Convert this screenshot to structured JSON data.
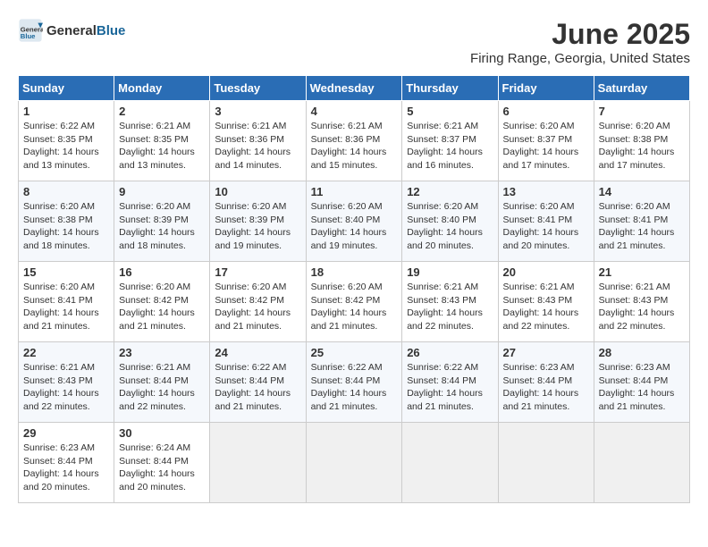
{
  "header": {
    "logo_general": "General",
    "logo_blue": "Blue",
    "month": "June 2025",
    "location": "Firing Range, Georgia, United States"
  },
  "weekdays": [
    "Sunday",
    "Monday",
    "Tuesday",
    "Wednesday",
    "Thursday",
    "Friday",
    "Saturday"
  ],
  "weeks": [
    [
      {
        "day": "1",
        "sunrise": "6:22 AM",
        "sunset": "8:35 PM",
        "daylight": "14 hours and 13 minutes."
      },
      {
        "day": "2",
        "sunrise": "6:21 AM",
        "sunset": "8:35 PM",
        "daylight": "14 hours and 13 minutes."
      },
      {
        "day": "3",
        "sunrise": "6:21 AM",
        "sunset": "8:36 PM",
        "daylight": "14 hours and 14 minutes."
      },
      {
        "day": "4",
        "sunrise": "6:21 AM",
        "sunset": "8:36 PM",
        "daylight": "14 hours and 15 minutes."
      },
      {
        "day": "5",
        "sunrise": "6:21 AM",
        "sunset": "8:37 PM",
        "daylight": "14 hours and 16 minutes."
      },
      {
        "day": "6",
        "sunrise": "6:20 AM",
        "sunset": "8:37 PM",
        "daylight": "14 hours and 17 minutes."
      },
      {
        "day": "7",
        "sunrise": "6:20 AM",
        "sunset": "8:38 PM",
        "daylight": "14 hours and 17 minutes."
      }
    ],
    [
      {
        "day": "8",
        "sunrise": "6:20 AM",
        "sunset": "8:38 PM",
        "daylight": "14 hours and 18 minutes."
      },
      {
        "day": "9",
        "sunrise": "6:20 AM",
        "sunset": "8:39 PM",
        "daylight": "14 hours and 18 minutes."
      },
      {
        "day": "10",
        "sunrise": "6:20 AM",
        "sunset": "8:39 PM",
        "daylight": "14 hours and 19 minutes."
      },
      {
        "day": "11",
        "sunrise": "6:20 AM",
        "sunset": "8:40 PM",
        "daylight": "14 hours and 19 minutes."
      },
      {
        "day": "12",
        "sunrise": "6:20 AM",
        "sunset": "8:40 PM",
        "daylight": "14 hours and 20 minutes."
      },
      {
        "day": "13",
        "sunrise": "6:20 AM",
        "sunset": "8:41 PM",
        "daylight": "14 hours and 20 minutes."
      },
      {
        "day": "14",
        "sunrise": "6:20 AM",
        "sunset": "8:41 PM",
        "daylight": "14 hours and 21 minutes."
      }
    ],
    [
      {
        "day": "15",
        "sunrise": "6:20 AM",
        "sunset": "8:41 PM",
        "daylight": "14 hours and 21 minutes."
      },
      {
        "day": "16",
        "sunrise": "6:20 AM",
        "sunset": "8:42 PM",
        "daylight": "14 hours and 21 minutes."
      },
      {
        "day": "17",
        "sunrise": "6:20 AM",
        "sunset": "8:42 PM",
        "daylight": "14 hours and 21 minutes."
      },
      {
        "day": "18",
        "sunrise": "6:20 AM",
        "sunset": "8:42 PM",
        "daylight": "14 hours and 21 minutes."
      },
      {
        "day": "19",
        "sunrise": "6:21 AM",
        "sunset": "8:43 PM",
        "daylight": "14 hours and 22 minutes."
      },
      {
        "day": "20",
        "sunrise": "6:21 AM",
        "sunset": "8:43 PM",
        "daylight": "14 hours and 22 minutes."
      },
      {
        "day": "21",
        "sunrise": "6:21 AM",
        "sunset": "8:43 PM",
        "daylight": "14 hours and 22 minutes."
      }
    ],
    [
      {
        "day": "22",
        "sunrise": "6:21 AM",
        "sunset": "8:43 PM",
        "daylight": "14 hours and 22 minutes."
      },
      {
        "day": "23",
        "sunrise": "6:21 AM",
        "sunset": "8:44 PM",
        "daylight": "14 hours and 22 minutes."
      },
      {
        "day": "24",
        "sunrise": "6:22 AM",
        "sunset": "8:44 PM",
        "daylight": "14 hours and 21 minutes."
      },
      {
        "day": "25",
        "sunrise": "6:22 AM",
        "sunset": "8:44 PM",
        "daylight": "14 hours and 21 minutes."
      },
      {
        "day": "26",
        "sunrise": "6:22 AM",
        "sunset": "8:44 PM",
        "daylight": "14 hours and 21 minutes."
      },
      {
        "day": "27",
        "sunrise": "6:23 AM",
        "sunset": "8:44 PM",
        "daylight": "14 hours and 21 minutes."
      },
      {
        "day": "28",
        "sunrise": "6:23 AM",
        "sunset": "8:44 PM",
        "daylight": "14 hours and 21 minutes."
      }
    ],
    [
      {
        "day": "29",
        "sunrise": "6:23 AM",
        "sunset": "8:44 PM",
        "daylight": "14 hours and 20 minutes."
      },
      {
        "day": "30",
        "sunrise": "6:24 AM",
        "sunset": "8:44 PM",
        "daylight": "14 hours and 20 minutes."
      },
      null,
      null,
      null,
      null,
      null
    ]
  ]
}
